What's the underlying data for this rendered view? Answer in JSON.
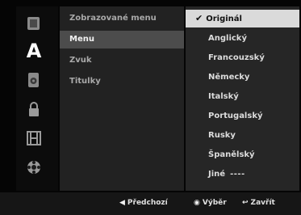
{
  "sidebar": {
    "icons": [
      "disc-icon",
      "language-icon",
      "audio-icon",
      "lock-icon",
      "film-icon",
      "settings-icon"
    ],
    "active_icon": "language-icon",
    "active_letter": "A"
  },
  "menu": {
    "items": [
      {
        "label": "Zobrazované menu",
        "active": false
      },
      {
        "label": "Menu",
        "active": true
      },
      {
        "label": "Zvuk",
        "active": false
      },
      {
        "label": "Titulky",
        "active": false
      }
    ]
  },
  "options": {
    "items": [
      {
        "label": "Originál",
        "selected": true
      },
      {
        "label": "Anglický"
      },
      {
        "label": "Francouzský"
      },
      {
        "label": "Německy"
      },
      {
        "label": "Italský"
      },
      {
        "label": "Portugalský"
      },
      {
        "label": "Rusky"
      },
      {
        "label": "Španělský"
      },
      {
        "label": "Jiné",
        "code": "----"
      }
    ]
  },
  "footer": {
    "prev_label": "Předchozí",
    "select_label": "Výběr",
    "close_label": "Zavřít"
  },
  "colors": {
    "background": "#050505",
    "menu_panel": "#222222",
    "option_panel": "#262626",
    "menu_highlight": "#4c4c4c",
    "option_selected": "#dadada"
  }
}
